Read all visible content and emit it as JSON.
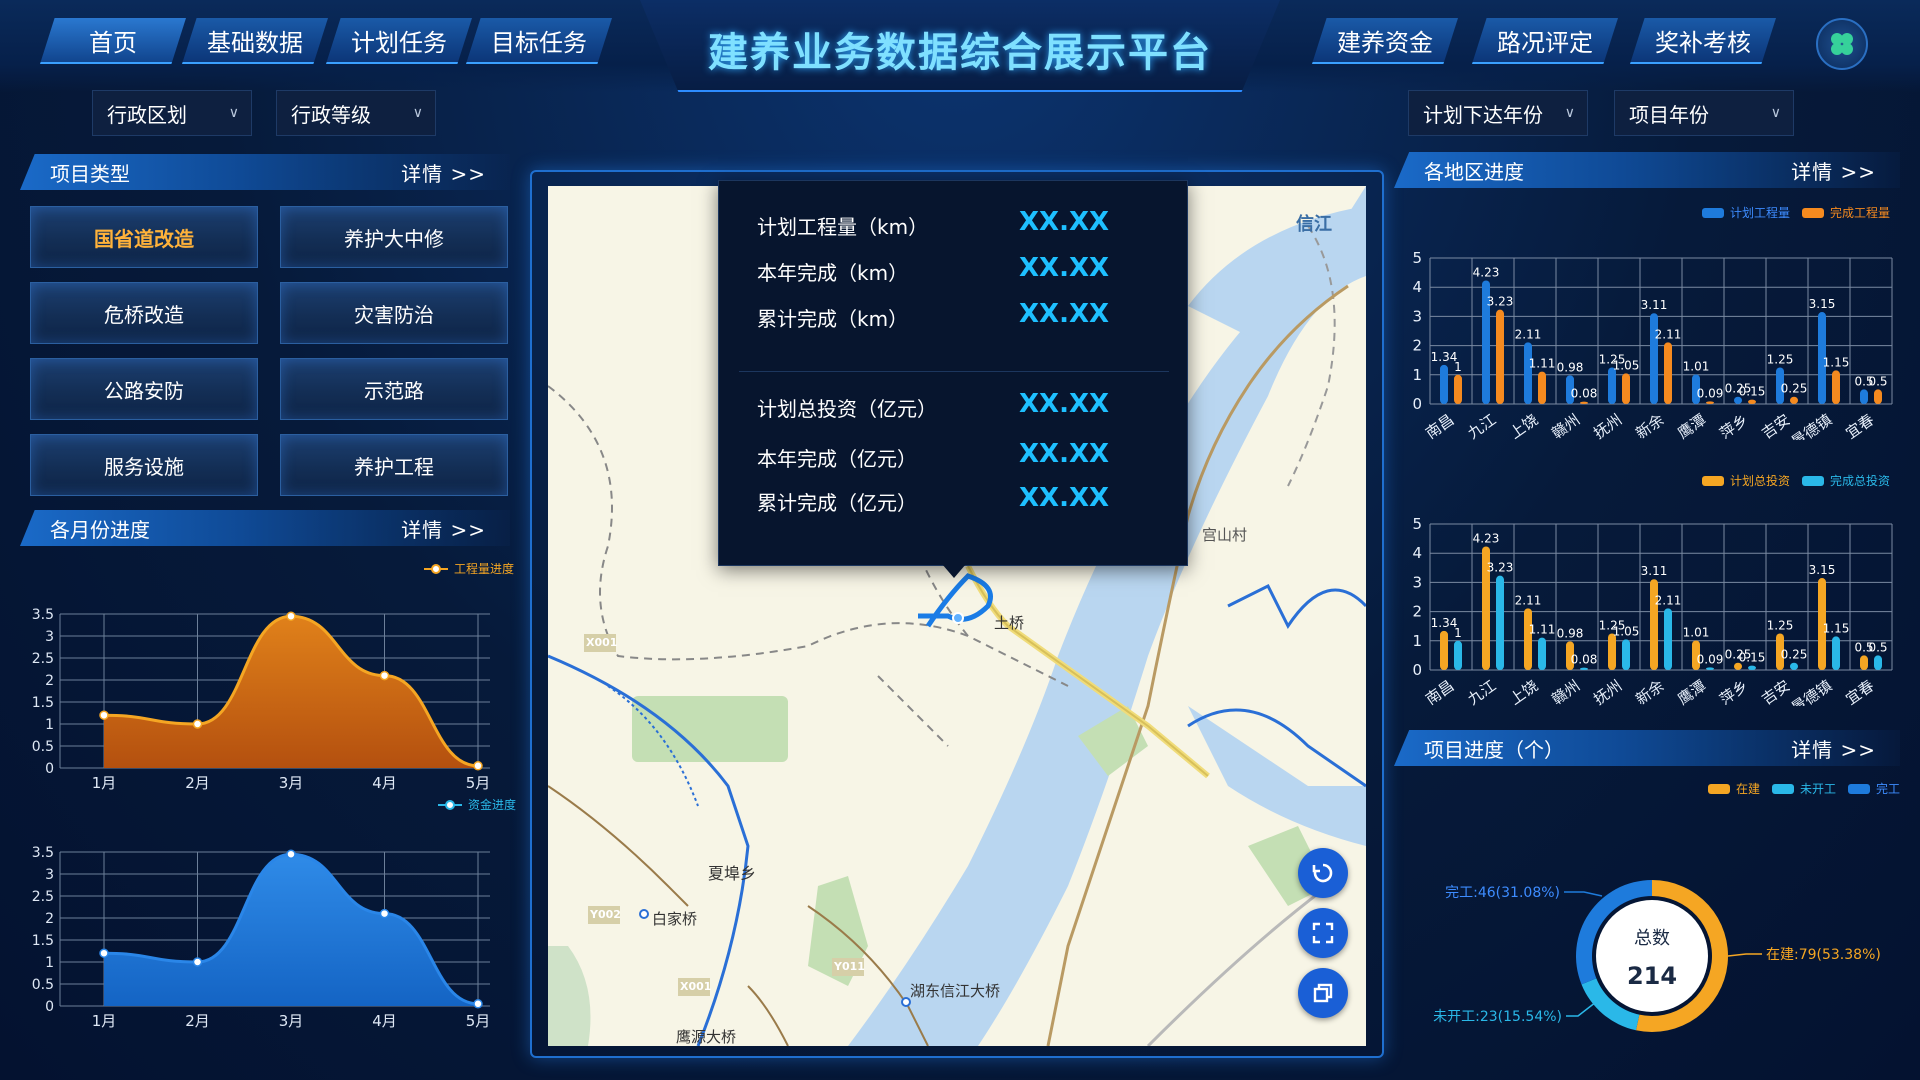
{
  "header": {
    "title": "建养业务数据综合展示平台",
    "nav_left": [
      "首页",
      "基础数据",
      "计划任务",
      "目标任务"
    ],
    "nav_right": [
      "建养资金",
      "路况评定",
      "奖补考核"
    ]
  },
  "filters": {
    "left": [
      "行政区划",
      "行政等级"
    ],
    "right": [
      "计划下达年份",
      "项目年份"
    ]
  },
  "project_type": {
    "title": "项目类型",
    "detail": "详情 >>",
    "items": [
      "国省道改造",
      "养护大中修",
      "危桥改造",
      "灾害防治",
      "公路安防",
      "示范路",
      "服务设施",
      "养护工程"
    ],
    "active_index": 0
  },
  "monthly": {
    "title": "各月份进度",
    "detail": "详情 >>",
    "legend1": "工程量进度",
    "legend2": "资金进度"
  },
  "region": {
    "title": "各地区进度",
    "detail": "详情 >>",
    "legend_a1": "计划工程量",
    "legend_a2": "完成工程量",
    "legend_b1": "计划总投资",
    "legend_b2": "完成总投资"
  },
  "project_progress": {
    "title": "项目进度（个）",
    "detail": "详情 >>",
    "legend": [
      "在建",
      "未开工",
      "完工"
    ],
    "center_label": "总数",
    "center_value": "214",
    "label_done": "完工:46(31.08%)",
    "label_building": "在建:79(53.38%)",
    "label_notstarted": "未开工:23(15.54%)"
  },
  "popup": {
    "rows": [
      {
        "label": "计划工程量（km）",
        "value": "XX.XX"
      },
      {
        "label": "本年完成（km）",
        "value": "XX.XX"
      },
      {
        "label": "累计完成（km）",
        "value": "XX.XX"
      },
      {
        "label": "计划总投资（亿元）",
        "value": "XX.XX"
      },
      {
        "label": "本年完成（亿元）",
        "value": "XX.XX"
      },
      {
        "label": "累计完成（亿元）",
        "value": "XX.XX"
      }
    ]
  },
  "map": {
    "labels": [
      "信江",
      "宫山村",
      "土桥",
      "夏埠乡",
      "白家桥",
      "湖东信江大桥",
      "鹰源大桥"
    ],
    "road_tags": [
      "X001",
      "Y002",
      "X001",
      "Y011"
    ]
  },
  "colors": {
    "orange": "#f5a623",
    "blue": "#1e7bdc",
    "cyan": "#2ab8e8",
    "accent": "#1ec0ff"
  },
  "chart_data": [
    {
      "type": "area",
      "name": "monthly-quantity",
      "categories": [
        "1月",
        "2月",
        "3月",
        "4月",
        "5月"
      ],
      "series": [
        {
          "name": "工程量进度",
          "values": [
            1.2,
            1.0,
            3.45,
            2.1,
            0.05
          ]
        }
      ],
      "ylim": [
        0,
        3.5
      ],
      "yticks": [
        "0",
        "0.5",
        "1",
        "1.5",
        "2",
        "2.5",
        "3",
        "3.5"
      ]
    },
    {
      "type": "area",
      "name": "monthly-funds",
      "categories": [
        "1月",
        "2月",
        "3月",
        "4月",
        "5月"
      ],
      "series": [
        {
          "name": "资金进度",
          "values": [
            1.2,
            1.0,
            3.45,
            2.1,
            0.05
          ]
        }
      ],
      "ylim": [
        0,
        3.5
      ],
      "yticks": [
        "0",
        "0.5",
        "1",
        "1.5",
        "2",
        "2.5",
        "3",
        "3.5"
      ]
    },
    {
      "type": "bar",
      "name": "region-quantity",
      "categories": [
        "南昌",
        "九江",
        "上饶",
        "赣州",
        "抚州",
        "新余",
        "鹰潭",
        "萍乡",
        "吉安",
        "景德镇",
        "宜春"
      ],
      "series": [
        {
          "name": "计划工程量",
          "values": [
            1.34,
            4.23,
            2.11,
            0.98,
            1.25,
            3.11,
            1.01,
            0.25,
            1.25,
            3.15,
            0.5
          ]
        },
        {
          "name": "完成工程量",
          "values": [
            1,
            3.23,
            1.11,
            0.08,
            1.05,
            2.11,
            0.09,
            0.15,
            0.25,
            1.15,
            0.5
          ]
        }
      ],
      "ylim": [
        0,
        5
      ],
      "yticks": [
        "0",
        "1",
        "2",
        "3",
        "4",
        "5"
      ]
    },
    {
      "type": "bar",
      "name": "region-investment",
      "categories": [
        "南昌",
        "九江",
        "上饶",
        "赣州",
        "抚州",
        "新余",
        "鹰潭",
        "萍乡",
        "吉安",
        "景德镇",
        "宜春"
      ],
      "series": [
        {
          "name": "计划总投资",
          "values": [
            1.34,
            4.23,
            2.11,
            0.98,
            1.25,
            3.11,
            1.01,
            0.25,
            1.25,
            3.15,
            0.5
          ]
        },
        {
          "name": "完成总投资",
          "values": [
            1,
            3.23,
            1.11,
            0.08,
            1.05,
            2.11,
            0.09,
            0.15,
            0.25,
            1.15,
            0.5
          ]
        }
      ],
      "ylim": [
        0,
        5
      ],
      "yticks": [
        "0",
        "1",
        "2",
        "3",
        "4",
        "5"
      ]
    },
    {
      "type": "pie",
      "name": "project-progress",
      "labels": [
        "在建",
        "未开工",
        "完工"
      ],
      "values": [
        79,
        23,
        46
      ]
    }
  ]
}
